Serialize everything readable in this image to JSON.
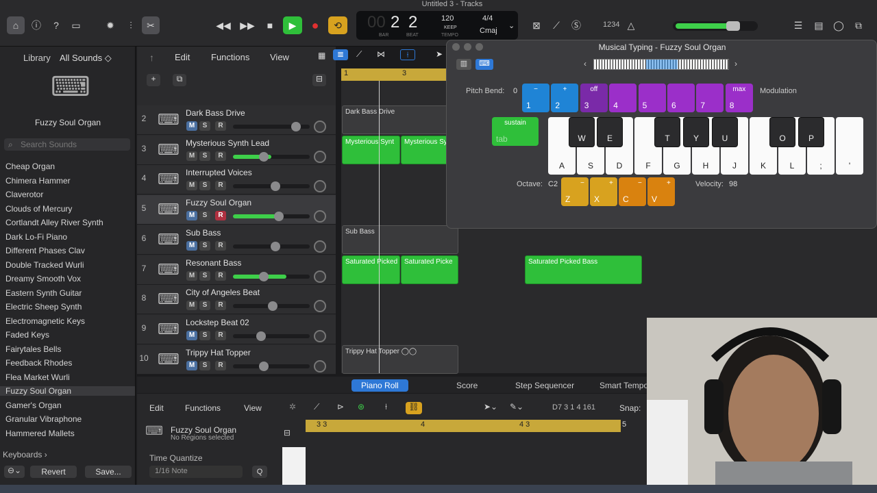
{
  "window_title": "Untitled 3 - Tracks",
  "transport": {
    "bar": "2",
    "beat": "2",
    "bar_label": "BAR",
    "beat_label": "BEAT",
    "tempo": "120",
    "tempo_mode": "KEEP",
    "tempo_label": "TEMPO",
    "time_sig": "4/4",
    "key": "Cmaj",
    "lcd_faded": "00"
  },
  "cpu_label": "1234",
  "library": {
    "title": "Library",
    "filter": "All Sounds ◇",
    "patch_name": "Fuzzy Soul Organ",
    "search_placeholder": "Search Sounds",
    "patches": [
      "Cheap Organ",
      "Chimera Hammer",
      "Claverotor",
      "Clouds of Mercury",
      "Cortlandt Alley River Synth",
      "Dark Lo-Fi Piano",
      "Different Phases Clav",
      "Double Tracked Wurli",
      "Dreamy Smooth Vox",
      "Eastern Synth Guitar",
      "Electric Sheep Synth",
      "Electromagnetic Keys",
      "Faded Keys",
      "Fairytales Bells",
      "Feedback Rhodes",
      "Flea Market Wurli",
      "Fuzzy Soul Organ",
      "Gamer's Organ",
      "Granular Vibraphone",
      "Hammered Mallets"
    ],
    "breadcrumb": "Keyboards ›",
    "revert": "Revert",
    "save": "Save..."
  },
  "arrange_menu": {
    "edit": "Edit",
    "functions": "Functions",
    "view": "View"
  },
  "tracks": [
    {
      "num": "2",
      "name": "Dark Bass Drive"
    },
    {
      "num": "3",
      "name": "Mysterious Synth Lead"
    },
    {
      "num": "4",
      "name": "Interrupted Voices"
    },
    {
      "num": "5",
      "name": "Fuzzy Soul Organ"
    },
    {
      "num": "6",
      "name": "Sub Bass"
    },
    {
      "num": "7",
      "name": "Resonant Bass"
    },
    {
      "num": "8",
      "name": "City of Angeles Beat"
    },
    {
      "num": "9",
      "name": "Lockstep Beat 02"
    },
    {
      "num": "10",
      "name": "Trippy Hat Topper"
    }
  ],
  "msr": {
    "m": "M",
    "s": "S",
    "r": "R"
  },
  "ruler": {
    "bar1": "1",
    "bar3": "3"
  },
  "regions": {
    "dark_bass": "Dark Bass Drive",
    "myst1": "Mysterious Synt",
    "myst2": "Mysterious Sy",
    "sub": "Sub Bass",
    "res1": "Saturated Picked",
    "res2": "Saturated Picke",
    "res3": "Saturated Picked Bass",
    "trippy": "Trippy Hat Topper  ◯◯"
  },
  "editor_tabs": [
    "Piano Roll",
    "Score",
    "Step Sequencer",
    "Smart Tempo"
  ],
  "editor": {
    "track": "Fuzzy Soul Organ",
    "sub": "No Regions selected",
    "edit": "Edit",
    "functions": "Functions",
    "view": "View",
    "position": "D7   3 1 4 161",
    "snap": "Snap:",
    "r33": "3 3",
    "r4": "4",
    "r43": "4 3",
    "r5": "5",
    "tq": "Time Quantize",
    "tq_val": "1/16 Note",
    "q": "Q"
  },
  "musical_typing": {
    "title": "Musical Typing - Fuzzy Soul Organ",
    "pitch_bend_label": "Pitch Bend:",
    "pitch_bend_val": "0",
    "modulation": "Modulation",
    "mod_keys": [
      {
        "t": "−",
        "b": "1"
      },
      {
        "t": "+",
        "b": "2"
      },
      {
        "t": "off",
        "b": "3"
      },
      {
        "t": "",
        "b": "4"
      },
      {
        "t": "",
        "b": "5"
      },
      {
        "t": "",
        "b": "6"
      },
      {
        "t": "",
        "b": "7"
      },
      {
        "t": "max",
        "b": "8"
      }
    ],
    "sustain": "sustain",
    "tab": "tab",
    "white_keys": [
      "A",
      "S",
      "D",
      "F",
      "G",
      "H",
      "J",
      "K",
      "L",
      ";",
      "'"
    ],
    "black_keys": [
      "W",
      "E",
      "T",
      "Y",
      "U",
      "O",
      "P"
    ],
    "octave_label": "Octave:",
    "octave_val": "C2",
    "oct_keys": [
      {
        "t": "−",
        "b": "Z"
      },
      {
        "t": "+",
        "b": "X"
      },
      {
        "t": "−",
        "b": "C"
      },
      {
        "t": "+",
        "b": "V"
      }
    ],
    "velocity_label": "Velocity:",
    "velocity_val": "98"
  },
  "colors": {
    "accent_blue": "#2e78d6",
    "region_green": "#2fbf3a",
    "ruler_gold": "#c8a83a",
    "purple": "#9b2fc9",
    "orange": "#d9820f"
  }
}
